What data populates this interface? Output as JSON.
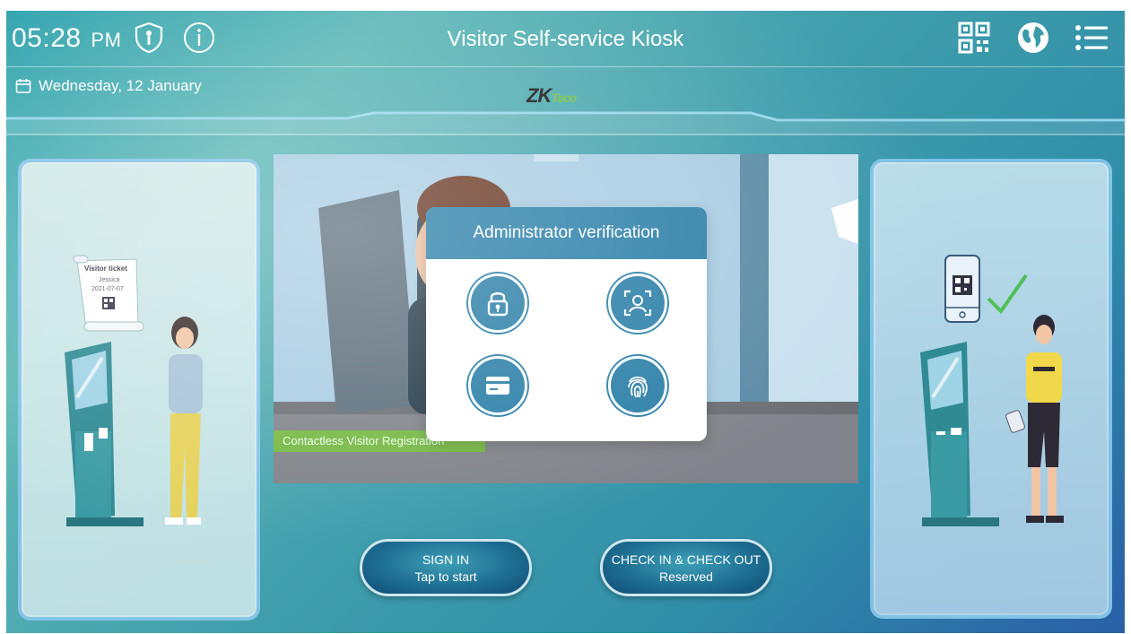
{
  "status_bar": {
    "time": "05:28",
    "ampm": "PM",
    "title": "Visitor Self-service Kiosk",
    "date": "Wednesday, 12 January"
  },
  "brand": {
    "logo_zk": "ZK",
    "logo_teco": "Teco"
  },
  "left_panel": {
    "ticket_title": "Visitor ticket",
    "ticket_name": "Jessica",
    "ticket_date": "2021-07-07"
  },
  "video": {
    "banner": "Contactless Visitor Registration"
  },
  "modal": {
    "title": "Administrator verification",
    "options": [
      {
        "icon": "password-lock-icon"
      },
      {
        "icon": "face-recognition-icon"
      },
      {
        "icon": "card-icon"
      },
      {
        "icon": "fingerprint-icon"
      }
    ]
  },
  "buttons": {
    "sign_in": {
      "line1": "SIGN IN",
      "line2": "Tap to start"
    },
    "check": {
      "line1": "CHECK IN & CHECK OUT",
      "line2": "Reserved"
    }
  },
  "colors": {
    "modal_accent": "#2b7fa8",
    "banner_green": "#76b843",
    "checkmark_green": "#4fbf5a"
  }
}
